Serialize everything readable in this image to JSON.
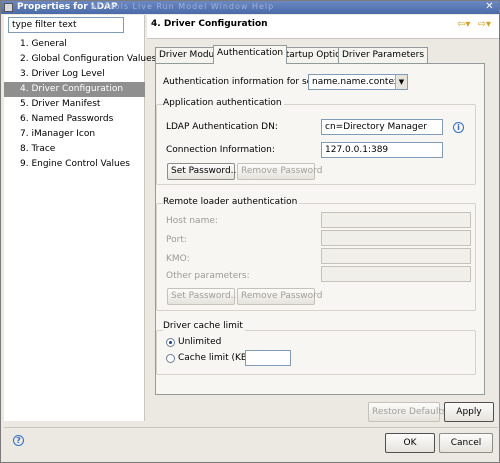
{
  "window": {
    "title": "Properties for LDAP",
    "background_menu": "ef  Tools  Live  Run  Model  Window  Help",
    "close_glyph": "✕"
  },
  "filter": {
    "value": "type filter text"
  },
  "nav": {
    "items": [
      "1. General",
      "2. Global Configuration Values",
      "3. Driver Log Level",
      "4. Driver Configuration",
      "5. Driver Manifest",
      "6. Named Passwords",
      "7. iManager Icon",
      "8. Trace",
      "9. Engine Control Values"
    ],
    "selected_index": 3
  },
  "header": {
    "title": "4. Driver Configuration",
    "back_arrow": "⇦▾",
    "forward_arrow": "⇨▾"
  },
  "tabs": [
    "Driver Module",
    "Authentication",
    "Startup Option",
    "Driver Parameters"
  ],
  "active_tab": "Authentication",
  "auth": {
    "server_label": "Authentication information for server:",
    "server_value": "name.name.context"
  },
  "app_auth": {
    "title": "Application authentication",
    "dn_label": "LDAP Authentication DN:",
    "dn_value": "cn=Directory Manager",
    "conn_label": "Connection Information:",
    "conn_value": "127.0.0.1:389",
    "set_password": "Set Password...",
    "remove_password": "Remove Password"
  },
  "remote": {
    "title": "Remote loader authentication",
    "host_label": "Host name:",
    "port_label": "Port:",
    "kmo_label": "KMO:",
    "other_label": "Other parameters:",
    "set_password": "Set Password...",
    "remove_password": "Remove Password"
  },
  "cache": {
    "title": "Driver cache limit",
    "unlimited": "Unlimited",
    "limit": "Cache limit (KB):",
    "selected": "Unlimited"
  },
  "buttons": {
    "restore": "Restore Defaults",
    "apply": "Apply",
    "ok": "OK",
    "cancel": "Cancel"
  },
  "icons": {
    "info": "i",
    "help": "?"
  }
}
